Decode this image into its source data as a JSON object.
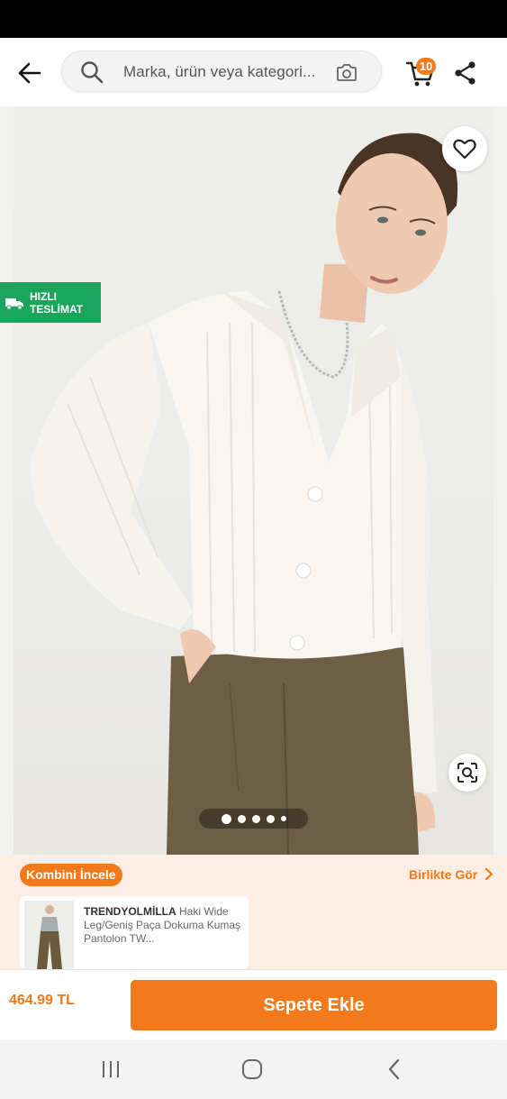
{
  "search": {
    "placeholder": "Marka, ürün veya kategori..."
  },
  "header": {
    "cart_count": "10"
  },
  "gallery": {
    "fast_delivery_line1": "HIZLI",
    "fast_delivery_line2": "TESLİMAT",
    "image_count": 5,
    "active_image_index": 0
  },
  "combo": {
    "chip_label": "Kombini İncele",
    "see_together_label": "Birlikte Gör",
    "card": {
      "brand": "TRENDYOLMİLLA",
      "title": "Haki Wide Leg/Geniş Paça Dokuma Kumaş Pantolon TW..."
    }
  },
  "bottom": {
    "price": "464.99 TL",
    "add_to_cart_label": "Sepete Ekle"
  },
  "colors": {
    "accent": "#f27a1a",
    "fast_delivery_green": "#1aa55a",
    "combo_background": "#fdeee3"
  },
  "icons": {
    "back": "arrow-left-icon",
    "search": "search-icon",
    "camera": "camera-search-icon",
    "cart": "cart-icon",
    "share": "share-icon",
    "favorite": "heart-icon",
    "truck": "truck-icon",
    "visual_search": "visual-search-icon",
    "chevron": "chevron-right-icon",
    "nav_recents": "recents-icon",
    "nav_home": "home-icon",
    "nav_back": "nav-back-icon"
  }
}
